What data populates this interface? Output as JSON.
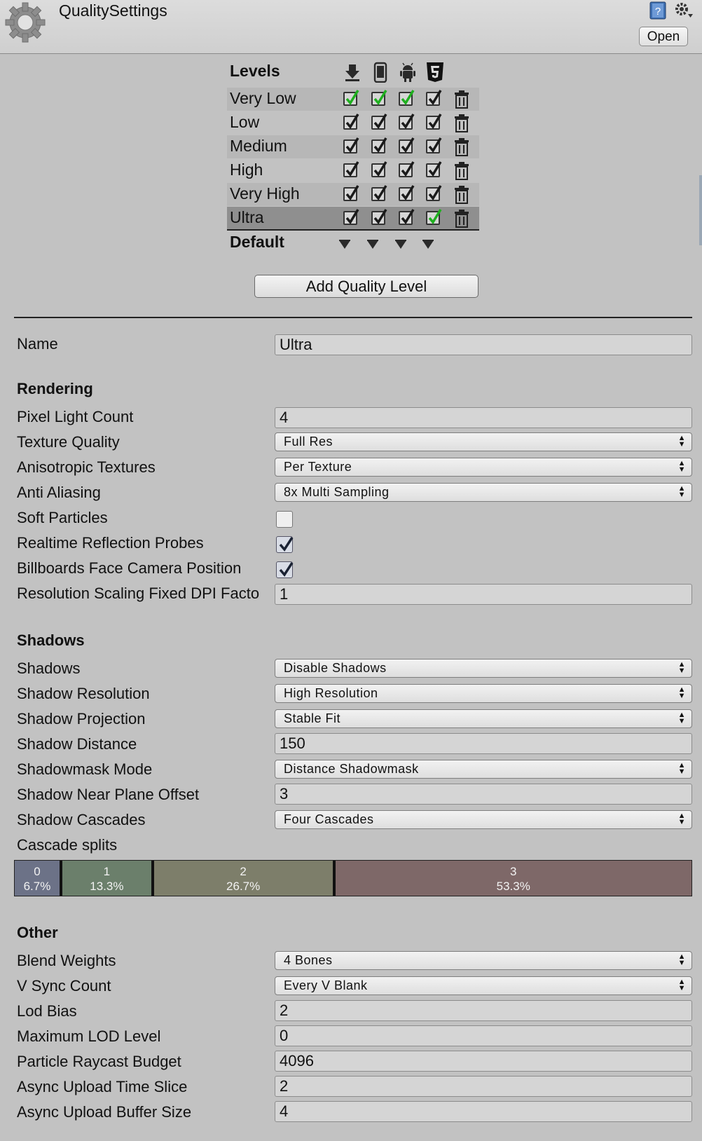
{
  "window": {
    "title": "QualitySettings",
    "open_label": "Open"
  },
  "levels": {
    "heading": "Levels",
    "platforms": [
      "download-icon",
      "phone-icon",
      "android-icon",
      "html5-icon"
    ],
    "rows": [
      {
        "name": "Very Low",
        "checks": [
          "green",
          "green",
          "green",
          "dark"
        ]
      },
      {
        "name": "Low",
        "checks": [
          "dark",
          "dark",
          "dark",
          "dark"
        ]
      },
      {
        "name": "Medium",
        "checks": [
          "dark",
          "dark",
          "dark",
          "dark"
        ]
      },
      {
        "name": "High",
        "checks": [
          "dark",
          "dark",
          "dark",
          "dark"
        ]
      },
      {
        "name": "Very High",
        "checks": [
          "dark",
          "dark",
          "dark",
          "dark"
        ]
      },
      {
        "name": "Ultra",
        "checks": [
          "dark",
          "dark",
          "dark",
          "green"
        ]
      }
    ],
    "selected": "Ultra",
    "default_label": "Default",
    "add_button": "Add Quality Level"
  },
  "name": {
    "label": "Name",
    "value": "Ultra"
  },
  "rendering": {
    "heading": "Rendering",
    "pixel_light_count": {
      "label": "Pixel Light Count",
      "value": "4"
    },
    "texture_quality": {
      "label": "Texture Quality",
      "value": "Full Res"
    },
    "anisotropic_textures": {
      "label": "Anisotropic Textures",
      "value": "Per Texture"
    },
    "anti_aliasing": {
      "label": "Anti Aliasing",
      "value": "8x Multi Sampling"
    },
    "soft_particles": {
      "label": "Soft Particles",
      "checked": false
    },
    "realtime_reflection_probes": {
      "label": "Realtime Reflection Probes",
      "checked": true
    },
    "billboards_face_camera": {
      "label": "Billboards Face Camera Position",
      "checked": true
    },
    "resolution_scaling_dpi": {
      "label": "Resolution Scaling Fixed DPI Facto",
      "value": "1"
    }
  },
  "shadows": {
    "heading": "Shadows",
    "shadows": {
      "label": "Shadows",
      "value": "Disable Shadows"
    },
    "shadow_resolution": {
      "label": "Shadow Resolution",
      "value": "High Resolution"
    },
    "shadow_projection": {
      "label": "Shadow Projection",
      "value": "Stable Fit"
    },
    "shadow_distance": {
      "label": "Shadow Distance",
      "value": "150"
    },
    "shadowmask_mode": {
      "label": "Shadowmask Mode",
      "value": "Distance Shadowmask"
    },
    "shadow_near_plane_offset": {
      "label": "Shadow Near Plane Offset",
      "value": "3"
    },
    "shadow_cascades": {
      "label": "Shadow Cascades",
      "value": "Four Cascades"
    },
    "cascade_splits": {
      "label": "Cascade splits",
      "segments": [
        {
          "index": "0",
          "percent": "6.7%",
          "fraction": 0.067,
          "color": "#6c7287"
        },
        {
          "index": "1",
          "percent": "13.3%",
          "fraction": 0.133,
          "color": "#6b7f6b"
        },
        {
          "index": "2",
          "percent": "26.7%",
          "fraction": 0.267,
          "color": "#7d7e6a"
        },
        {
          "index": "3",
          "percent": "53.3%",
          "fraction": 0.533,
          "color": "#7e6868"
        }
      ]
    }
  },
  "other": {
    "heading": "Other",
    "blend_weights": {
      "label": "Blend Weights",
      "value": "4 Bones"
    },
    "v_sync_count": {
      "label": "V Sync Count",
      "value": "Every V Blank"
    },
    "lod_bias": {
      "label": "Lod Bias",
      "value": "2"
    },
    "maximum_lod_level": {
      "label": "Maximum LOD Level",
      "value": "0"
    },
    "particle_raycast_budget": {
      "label": "Particle Raycast Budget",
      "value": "4096"
    },
    "async_upload_time_slice": {
      "label": "Async Upload Time Slice",
      "value": "2"
    },
    "async_upload_buffer_size": {
      "label": "Async Upload Buffer Size",
      "value": "4"
    }
  },
  "colors": {
    "check_green": "#1fb01f",
    "selected_row": "#8f8f8f",
    "panel_bg": "#c2c2c2"
  }
}
